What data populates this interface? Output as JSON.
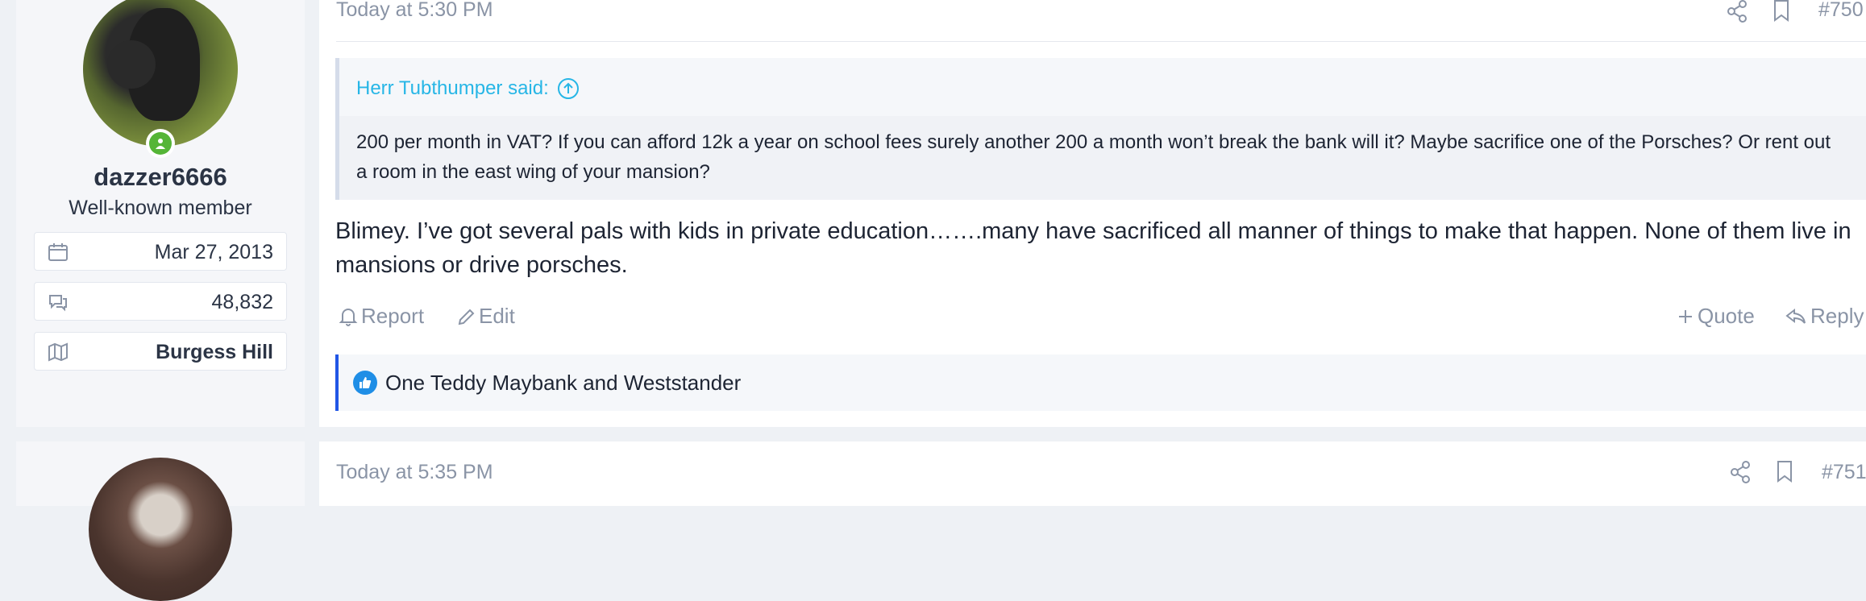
{
  "user": {
    "username": "dazzer6666",
    "title": "Well-known member",
    "joined": "Mar 27, 2013",
    "messages": "48,832",
    "location": "Burgess Hill",
    "online_color": "#55b537"
  },
  "post": {
    "time": "Today at 5:30 PM",
    "number": "#750",
    "quote_author": "Herr Tubthumper said:",
    "quote_text": "200 per month in VAT? If you can afford 12k a year on school fees surely another 200 a month won’t break the bank will it? Maybe sacrifice one of the Porsches? Or rent out a room in the east wing of your mansion?",
    "body": "Blimey. I’ve got several pals with kids in private education…….many have sacrificed all manner of things to make that happen. None of them live in mansions or drive porsches.",
    "actions": {
      "report": "Report",
      "edit": "Edit",
      "quote": "Quote",
      "reply": "Reply"
    },
    "reactions": "One Teddy Maybank and Weststander",
    "icons": [
      "share-icon",
      "bookmark-icon",
      "bell-icon",
      "pencil-icon",
      "plus-icon",
      "reply-icon",
      "like-icon"
    ]
  },
  "next_post": {
    "time": "Today at 5:35 PM",
    "number": "#751"
  },
  "colors": {
    "quote_link": "#27b6e6",
    "reaction_bar": "#2156e6",
    "like": "#1f8ee6"
  }
}
